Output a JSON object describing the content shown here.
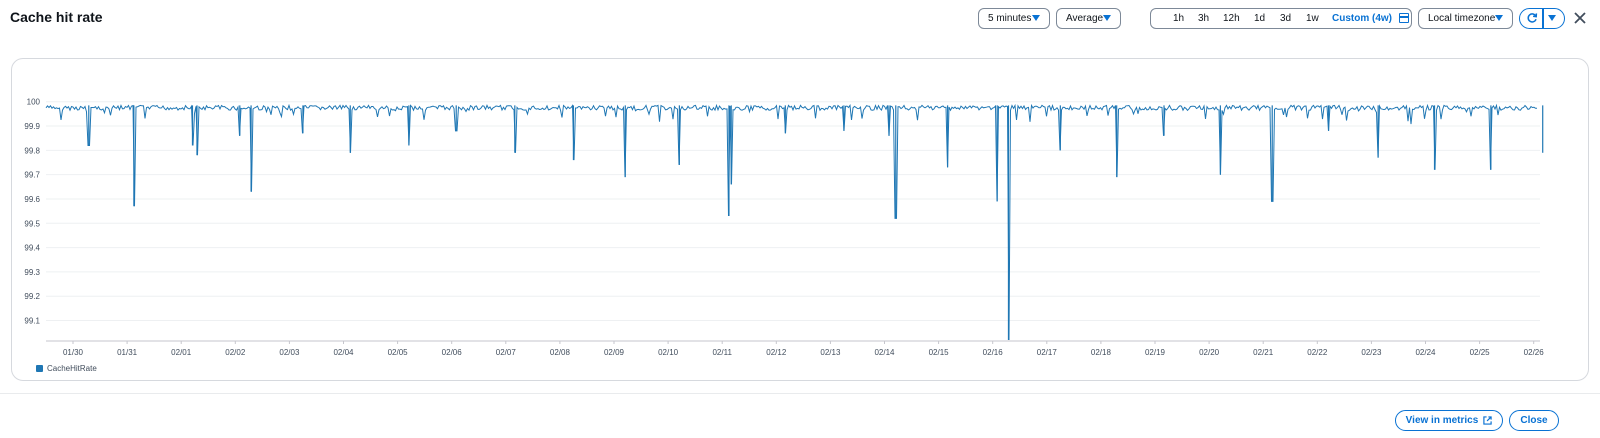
{
  "header": {
    "title": "Cache hit rate",
    "period": "5 minutes",
    "statistic": "Average",
    "time_range": {
      "options": [
        "1h",
        "3h",
        "12h",
        "1d",
        "3d",
        "1w"
      ],
      "custom": "Custom (4w)",
      "selected": "Custom (4w)"
    },
    "timezone": "Local timezone"
  },
  "footer": {
    "view_in_metrics": "View in metrics",
    "close": "Close"
  },
  "colors": {
    "accent": "#0972d3",
    "series": "#1f77b4",
    "border": "#7d8998"
  },
  "icons": [
    "chevron-down-icon",
    "calendar-icon",
    "refresh-icon",
    "close-icon",
    "external-link-icon"
  ],
  "chart_data": {
    "type": "line",
    "title": "",
    "xlabel": "",
    "ylabel": "",
    "ylim": [
      99.02,
      100.04
    ],
    "y_ticks": [
      100,
      99.9,
      99.8,
      99.7,
      99.6,
      99.5,
      99.4,
      99.3,
      99.2,
      99.1
    ],
    "x_ticks": [
      "01/30",
      "01/31",
      "02/01",
      "02/02",
      "02/03",
      "02/04",
      "02/05",
      "02/06",
      "02/07",
      "02/08",
      "02/09",
      "02/10",
      "02/11",
      "02/12",
      "02/13",
      "02/14",
      "02/15",
      "02/16",
      "02/17",
      "02/18",
      "02/19",
      "02/20",
      "02/21",
      "02/22",
      "02/23",
      "02/24",
      "02/25",
      "02/26"
    ],
    "x_start": "01/29 12:00",
    "legend": {
      "position": "bottom-left"
    },
    "grid": true,
    "series": [
      {
        "name": "CacheHitRate",
        "color": "#1f77b4",
        "baseline": 99.985,
        "dips": [
          {
            "x": "01/30 07:00",
            "y": 99.82
          },
          {
            "x": "01/31 03:00",
            "y": 99.57
          },
          {
            "x": "02/01 05:00",
            "y": 99.82
          },
          {
            "x": "02/01 07:00",
            "y": 99.78
          },
          {
            "x": "02/02 02:00",
            "y": 99.86
          },
          {
            "x": "02/02 07:00",
            "y": 99.63
          },
          {
            "x": "02/03 06:00",
            "y": 99.87
          },
          {
            "x": "02/04 03:00",
            "y": 99.79
          },
          {
            "x": "02/05 05:00",
            "y": 99.82
          },
          {
            "x": "02/06 02:00",
            "y": 99.88
          },
          {
            "x": "02/07 04:00",
            "y": 99.79
          },
          {
            "x": "02/08 06:00",
            "y": 99.76
          },
          {
            "x": "02/09 05:00",
            "y": 99.69
          },
          {
            "x": "02/10 05:00",
            "y": 99.74
          },
          {
            "x": "02/11 03:00",
            "y": 99.53
          },
          {
            "x": "02/11 04:00",
            "y": 99.66
          },
          {
            "x": "02/12 04:00",
            "y": 99.87
          },
          {
            "x": "02/13 06:00",
            "y": 99.88
          },
          {
            "x": "02/14 02:00",
            "y": 99.86
          },
          {
            "x": "02/14 05:00",
            "y": 99.52
          },
          {
            "x": "02/15 04:00",
            "y": 99.73
          },
          {
            "x": "02/16 02:00",
            "y": 99.59
          },
          {
            "x": "02/16 07:00",
            "y": 99.02
          },
          {
            "x": "02/17 06:00",
            "y": 99.8
          },
          {
            "x": "02/18 07:00",
            "y": 99.69
          },
          {
            "x": "02/19 04:00",
            "y": 99.86
          },
          {
            "x": "02/20 05:00",
            "y": 99.7
          },
          {
            "x": "02/21 04:00",
            "y": 99.59
          },
          {
            "x": "02/22 05:00",
            "y": 99.88
          },
          {
            "x": "02/23 03:00",
            "y": 99.77
          },
          {
            "x": "02/24 04:00",
            "y": 99.72
          },
          {
            "x": "02/25 05:00",
            "y": 99.72
          },
          {
            "x": "02/26 04:00",
            "y": 99.79
          }
        ]
      }
    ]
  }
}
